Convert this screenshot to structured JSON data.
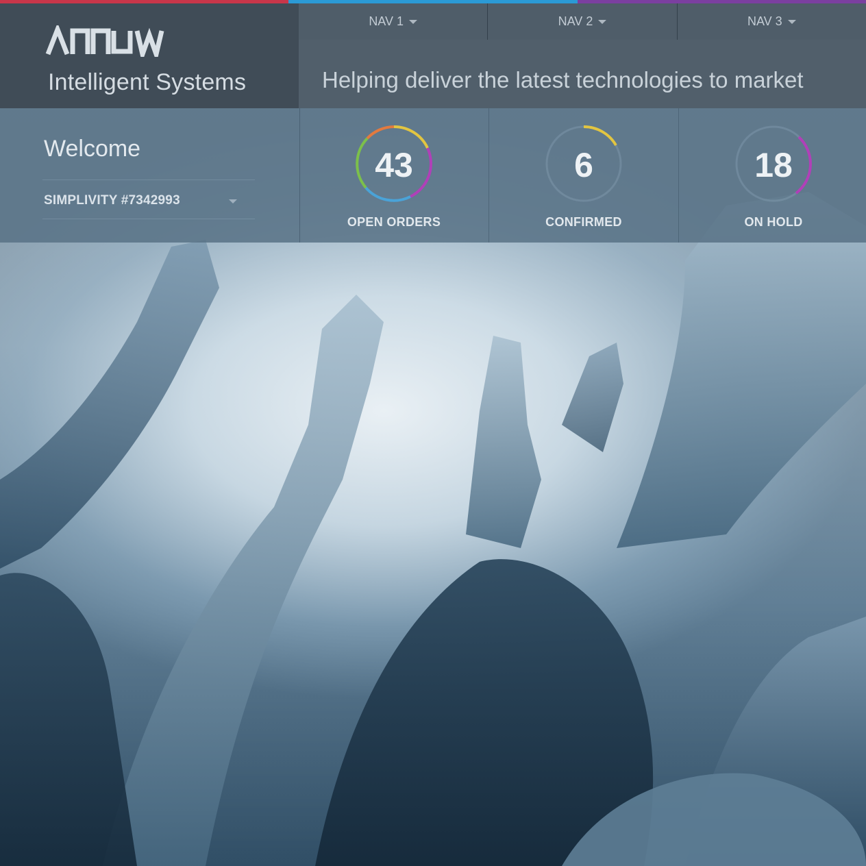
{
  "colors": {
    "accent_red": "#c8364a",
    "accent_blue": "#2b9ad6",
    "accent_purple": "#7b3fa0",
    "ring_green": "#7cc04b",
    "ring_yellow": "#e2c541",
    "ring_purple": "#b040b8",
    "ring_blue": "#4aa3d8"
  },
  "brand": {
    "logo": "ARROW",
    "subtitle": "Intelligent Systems"
  },
  "nav": {
    "items": [
      {
        "label": "NAV 1"
      },
      {
        "label": "NAV 2"
      },
      {
        "label": "NAV 3"
      }
    ]
  },
  "tagline": "Helping deliver the latest technologies to market",
  "welcome": {
    "title": "Welcome",
    "account": "SIMPLIVITY #7342993"
  },
  "stats": [
    {
      "value": "43",
      "label": "OPEN ORDERS",
      "icon": "progress-ring-icon"
    },
    {
      "value": "6",
      "label": "CONFIRMED",
      "icon": "progress-ring-icon"
    },
    {
      "value": "18",
      "label": "ON HOLD",
      "icon": "progress-ring-icon"
    }
  ]
}
